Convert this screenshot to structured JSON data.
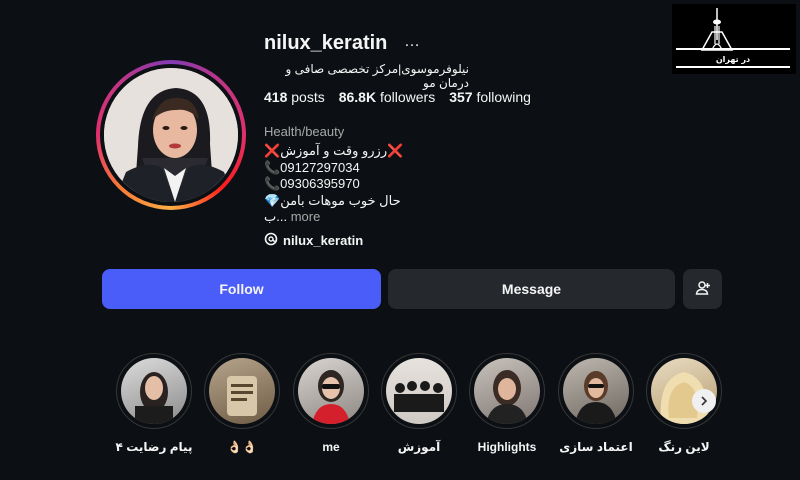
{
  "profile": {
    "username": "nilux_keratin",
    "options_icon": "…",
    "full_name": "نیلوفرموسوی|مرکز تخصصی صافی و درمان مو",
    "stats": {
      "posts_count": "418",
      "posts_label": "posts",
      "followers_count": "86.8K",
      "followers_label": "followers",
      "following_count": "357",
      "following_label": "following"
    },
    "category": "Health/beauty",
    "bio_lines": [
      "❌رزرو وقت و آموزش❌",
      "📞09127297034",
      "📞09306395970",
      "💎حال خوب موهات بامن",
      "ب..."
    ],
    "more_label": "more",
    "threads_handle": "nilux_keratin"
  },
  "actions": {
    "follow_label": "Follow",
    "message_label": "Message",
    "suggest_icon": "add-person-icon"
  },
  "highlights": [
    {
      "label": "پیام رضایت ۴"
    },
    {
      "label": "👌🏻👌🏻"
    },
    {
      "label": "me"
    },
    {
      "label": "آموزش"
    },
    {
      "label": "Highlights"
    },
    {
      "label": "اعتماد سازی"
    },
    {
      "label": "لاین رنگ"
    }
  ],
  "watermark": {
    "text": "در تهران"
  },
  "colors": {
    "background": "#0c1014",
    "follow_button": "#4a5df9",
    "secondary_button": "#25292e",
    "muted_text": "#a8a8a8"
  }
}
